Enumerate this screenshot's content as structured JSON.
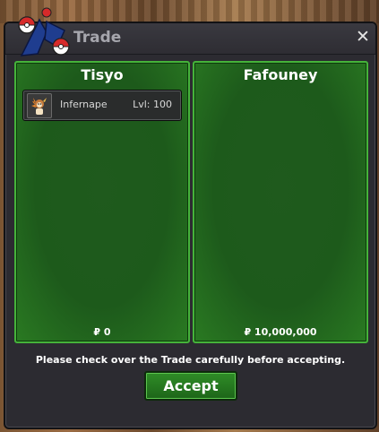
{
  "window": {
    "title": "Trade",
    "close_icon": "close-icon",
    "emblem_icon": "pokeball-emblem-icon"
  },
  "left_panel": {
    "name": "Tisyo",
    "money": "₽ 0",
    "items": [
      {
        "name": "Infernape",
        "level": "Lvl: 100",
        "icon": "infernape-icon"
      }
    ]
  },
  "right_panel": {
    "name": "Fafouney",
    "money": "₽ 10,000,000",
    "items": []
  },
  "footer": {
    "notice": "Please check over the Trade carefully before accepting.",
    "accept_label": "Accept"
  },
  "colors": {
    "panel_green": "#1f5a1d",
    "panel_border": "#45b33a",
    "window_bg": "#2c2b31",
    "title_text": "#a6a6ad"
  }
}
